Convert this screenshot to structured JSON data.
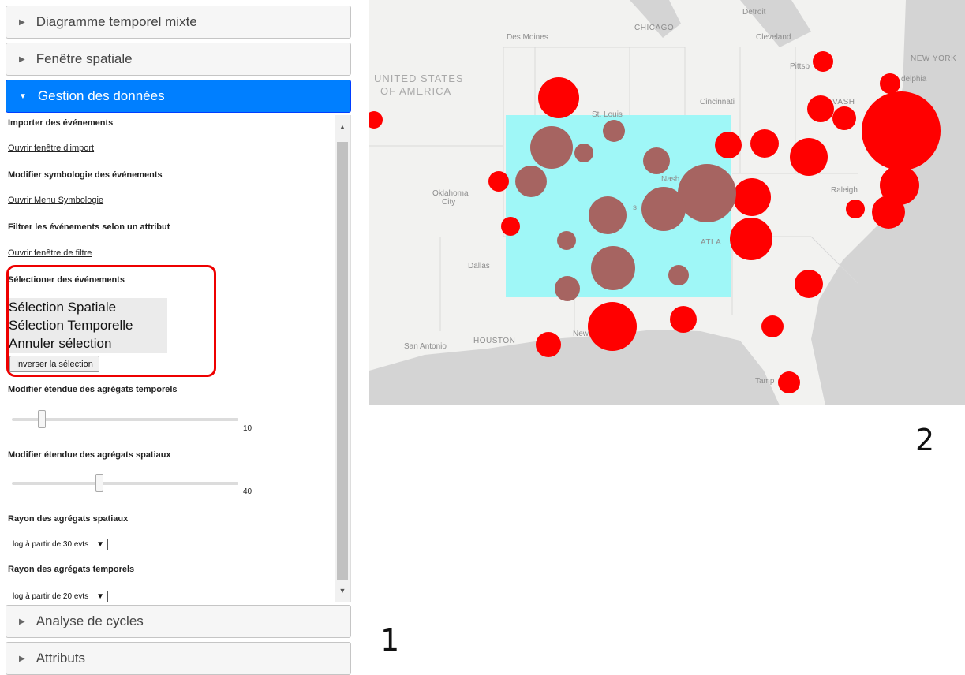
{
  "sidebar": {
    "headers": [
      {
        "label": "Diagramme temporel mixte"
      },
      {
        "label": "Fenêtre spatiale"
      },
      {
        "label": "Gestion des données"
      },
      {
        "label": "Analyse de cycles"
      },
      {
        "label": "Attributs"
      }
    ],
    "panel": {
      "import_label": "Importer des événements",
      "import_link": "Ouvrir fenêtre d'import",
      "symbology_label": "Modifier symbologie des événements",
      "symbology_link": "Ouvrir Menu Symbologie",
      "filter_label": "Filtrer les événements selon un attribut",
      "filter_link": "Ouvrir fenêtre de filtre",
      "select_label": "Sélectioner des événements",
      "select_options": [
        "Sélection Spatiale",
        "Sélection Temporelle",
        "Annuler sélection"
      ],
      "invert_button": "Inverser la sélection",
      "temporal_extent_label": "Modifier étendue des agrégats temporels",
      "temporal_extent_value": "10",
      "spatial_extent_label": "Modifier étendue des agrégats spatiaux",
      "spatial_extent_value": "40",
      "spatial_radius_label": "Rayon des agrégats spatiaux",
      "spatial_radius_value": "log à partir de 30 evts",
      "temporal_radius_label": "Rayon des agrégats temporels",
      "temporal_radius_value": "log à partir de 20 evts"
    }
  },
  "map": {
    "labels": {
      "usa1": "UNITED STATES",
      "usa2": "OF AMERICA",
      "detroit": "Detroit",
      "chicago": "CHICAGO",
      "desmoines": "Des Moines",
      "cleveland": "Cleveland",
      "pittsburgh": "Pittsb",
      "newyork": "NEW YORK",
      "philadelphia": "delphia",
      "stlouis": "St. Louis",
      "cincinnati": "Cincinnati",
      "washington": "VASH",
      "oklahoma1": "Oklahoma",
      "oklahoma2": "City",
      "nashville": "Nash",
      "raleigh": "Raleigh",
      "memphis": "s",
      "atlanta": "ATLA",
      "dallas": "Dallas",
      "houston": "HOUSTON",
      "sanantonio": "San Antonio",
      "neworleans": "New",
      "tampa": "Tamp"
    },
    "colors": {
      "event": "#ff0000",
      "selected_event": "#a66461",
      "selection": "#9ff7f7",
      "land": "#f2f2f0",
      "water": "#d4d4d4"
    }
  },
  "figure_numbers": {
    "sidebar": "1",
    "map": "2"
  }
}
